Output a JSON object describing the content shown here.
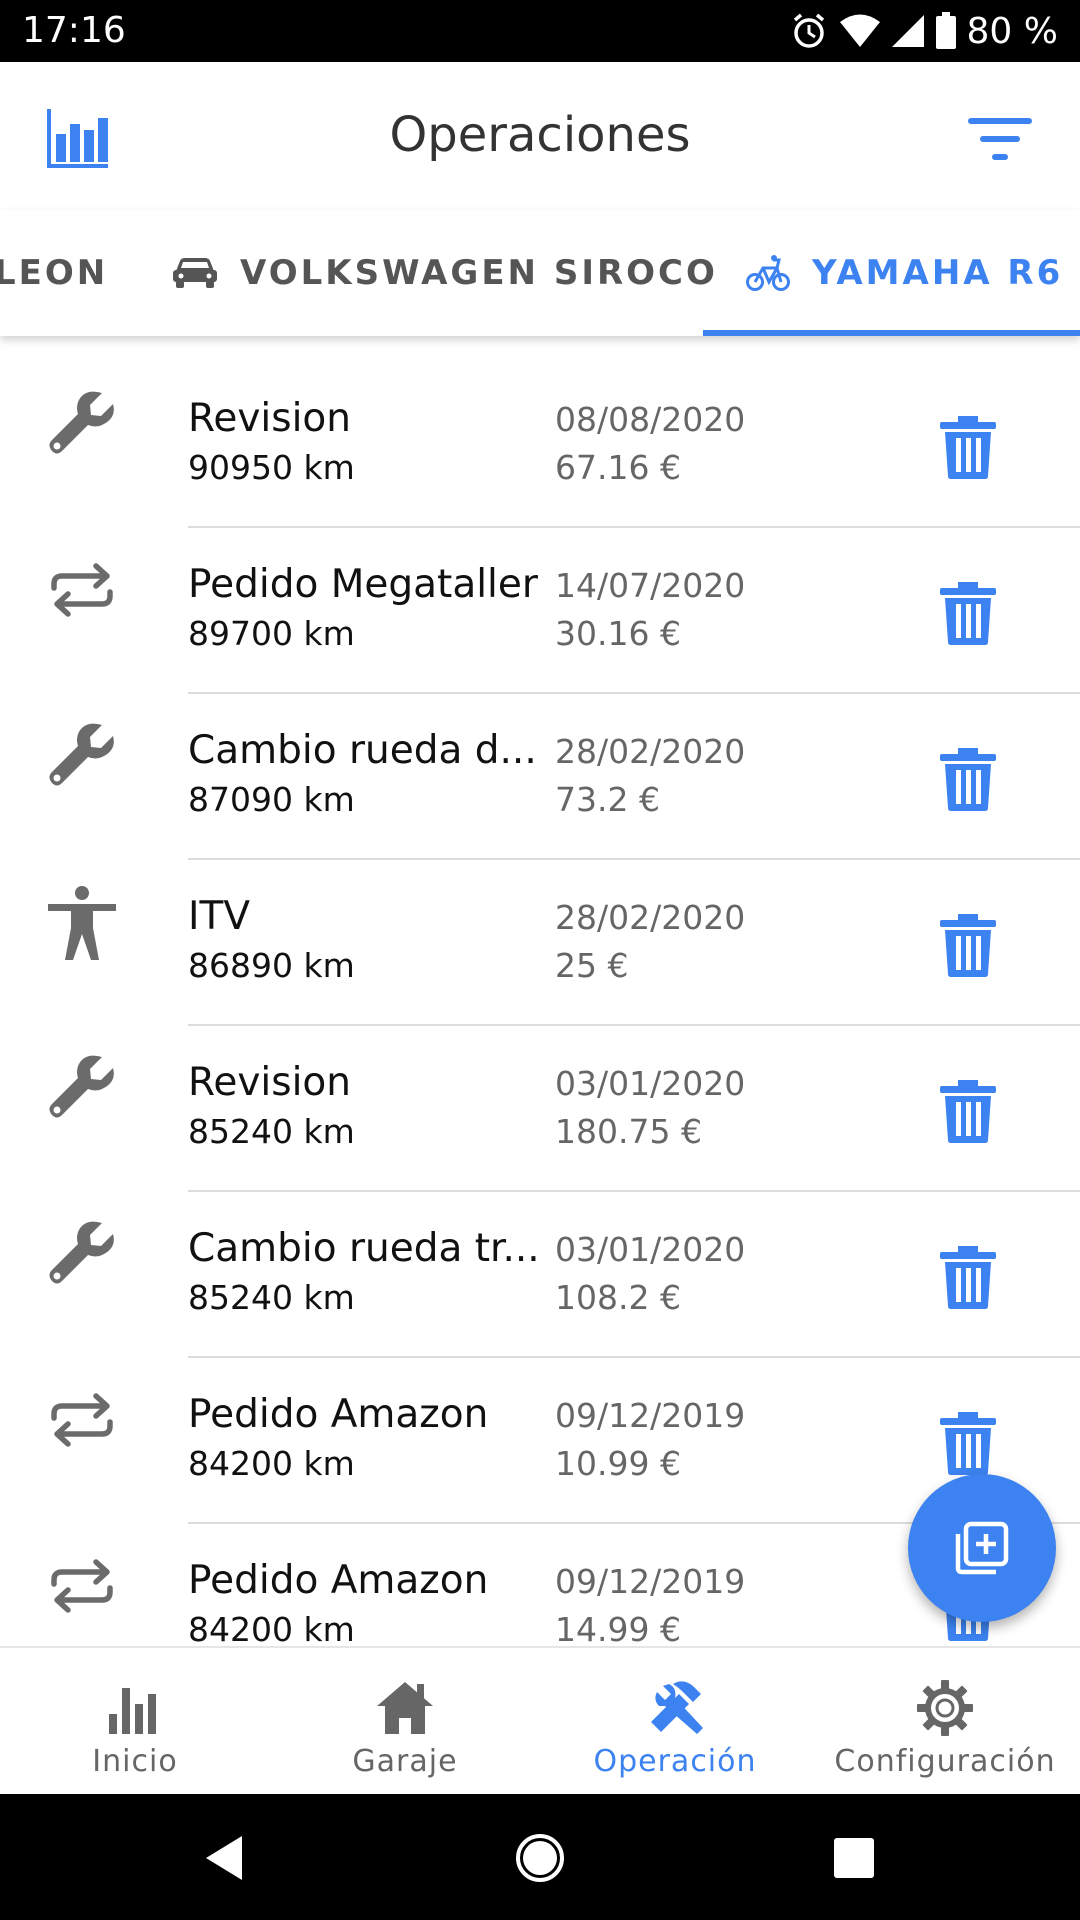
{
  "status_bar": {
    "time": "17:16",
    "battery": "80 %"
  },
  "header": {
    "title": "Operaciones"
  },
  "tabs": [
    {
      "label": "LEON"
    },
    {
      "label": "VOLKSWAGEN SIROCO"
    },
    {
      "label": "YAMAHA R6"
    }
  ],
  "operations": [
    {
      "type": "wrench-icon",
      "title": "Revision",
      "km": "90950 km",
      "date": "08/08/2020",
      "price": "67.16 €"
    },
    {
      "type": "swap-icon",
      "title": "Pedido Megataller",
      "km": "89700 km",
      "date": "14/07/2020",
      "price": "30.16 €"
    },
    {
      "type": "wrench-icon",
      "title": "Cambio rueda d...",
      "km": "87090 km",
      "date": "28/02/2020",
      "price": "73.2 €"
    },
    {
      "type": "person-icon",
      "title": "ITV",
      "km": "86890 km",
      "date": "28/02/2020",
      "price": "25 €"
    },
    {
      "type": "wrench-icon",
      "title": "Revision",
      "km": "85240 km",
      "date": "03/01/2020",
      "price": "180.75 €"
    },
    {
      "type": "wrench-icon",
      "title": "Cambio rueda tr...",
      "km": "85240 km",
      "date": "03/01/2020",
      "price": "108.2 €"
    },
    {
      "type": "swap-icon",
      "title": "Pedido Amazon",
      "km": "84200 km",
      "date": "09/12/2019",
      "price": "10.99 €"
    },
    {
      "type": "swap-icon",
      "title": "Pedido Amazon",
      "km": "84200 km",
      "date": "09/12/2019",
      "price": "14.99 €"
    }
  ],
  "bottom_nav": [
    {
      "label": "Inicio",
      "icon": "bar-chart-icon"
    },
    {
      "label": "Garaje",
      "icon": "home-icon"
    },
    {
      "label": "Operación",
      "icon": "tools-icon"
    },
    {
      "label": "Configuración",
      "icon": "gear-icon"
    }
  ],
  "colors": {
    "accent": "#3c82f0",
    "icon_gray": "#6b6b6b"
  }
}
